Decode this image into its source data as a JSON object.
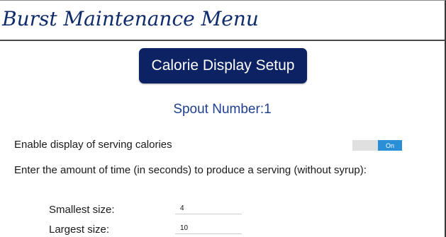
{
  "header": {
    "title": "Burst Maintenance Menu"
  },
  "setup_button": {
    "label": "Calorie Display Setup"
  },
  "spout": {
    "label": "Spout Number:1"
  },
  "enable_calories": {
    "label": "Enable display of serving calories",
    "toggle_state": "On"
  },
  "instruction": {
    "text": "Enter the amount of time (in seconds) to produce a serving (without syrup):"
  },
  "sizes": {
    "smallest_label": "Smallest size:",
    "smallest_value": "4",
    "largest_label": "Largest size:",
    "largest_value": "10"
  },
  "colors": {
    "brand_navy": "#0d2262",
    "title_blue": "#0e2b6b",
    "spout_blue": "#1f3f8f",
    "toggle_on": "#2a8fd6"
  }
}
